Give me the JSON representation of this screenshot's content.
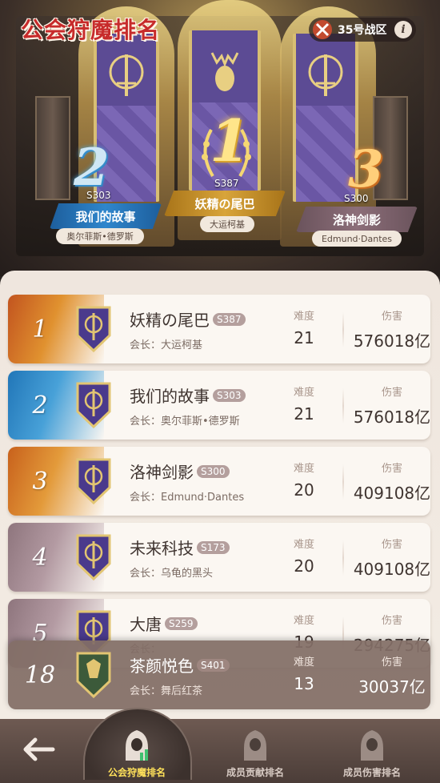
{
  "header": {
    "title": "公会狩魔排名",
    "zone_label": "35号战区",
    "info_label": "i"
  },
  "podium": [
    {
      "rank": "2",
      "server": "S303",
      "guild": "我们的故事",
      "leader": "奥尔菲斯•德罗斯",
      "color": "#2f86cc"
    },
    {
      "rank": "1",
      "server": "S387",
      "guild": "妖精の尾巴",
      "leader": "大运柯基",
      "color": "#d8a43a"
    },
    {
      "rank": "3",
      "server": "S300",
      "guild": "洛神剑影",
      "leader": "Edmund·Dantes",
      "color": "#8c6e79"
    }
  ],
  "columns": {
    "difficulty": "难度",
    "damage": "伤害",
    "leader_prefix": "会长："
  },
  "rows": [
    {
      "rank": "1",
      "guild": "妖精の尾巴",
      "server": "S387",
      "leader": "大运柯基",
      "difficulty": "21",
      "damage": "576018亿",
      "shield_color": "#4a3a8c",
      "style": "gold"
    },
    {
      "rank": "2",
      "guild": "我们的故事",
      "server": "S303",
      "leader": "奥尔菲斯•德罗斯",
      "difficulty": "21",
      "damage": "576018亿",
      "shield_color": "#4a3a8c",
      "style": "blue"
    },
    {
      "rank": "3",
      "guild": "洛神剑影",
      "server": "S300",
      "leader": "Edmund·Dantes",
      "difficulty": "20",
      "damage": "409108亿",
      "shield_color": "#4a3a8c",
      "style": "orange"
    },
    {
      "rank": "4",
      "guild": "未来科技",
      "server": "S173",
      "leader": "乌龟的黑头",
      "difficulty": "20",
      "damage": "409108亿",
      "shield_color": "#4a3a8c",
      "style": "mauve"
    },
    {
      "rank": "5",
      "guild": "大唐",
      "server": "S259",
      "leader": "",
      "difficulty": "19",
      "damage": "294275亿",
      "shield_color": "#4a3a8c",
      "style": "mauve"
    }
  ],
  "my_guild": {
    "rank": "18",
    "guild": "茶颜悦色",
    "server": "S401",
    "leader": "舞后红茶",
    "difficulty": "13",
    "damage": "30037亿",
    "shield_color": "#3c5a3a"
  },
  "nav": {
    "back_label": "",
    "tabs": [
      {
        "label": "公会狩魔排名",
        "active": true
      },
      {
        "label": "成员贡献排名",
        "active": false
      },
      {
        "label": "成员伤害排名",
        "active": false
      }
    ]
  }
}
